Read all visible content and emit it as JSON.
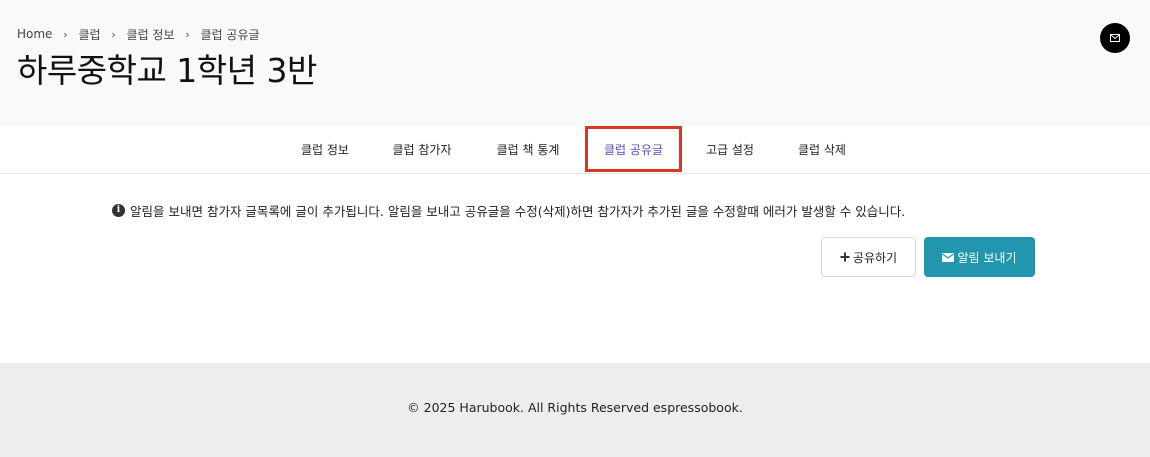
{
  "breadcrumb": {
    "items": [
      "Home",
      "클럽",
      "클럽 정보",
      "클럽 공유글"
    ]
  },
  "header": {
    "title": "하루중학교 1학년 3반"
  },
  "tabs": [
    {
      "label": "클럽 정보"
    },
    {
      "label": "클럽 참가자"
    },
    {
      "label": "클럽 책 통계"
    },
    {
      "label": "클럽 공유글",
      "active": true
    },
    {
      "label": "고급 설정"
    },
    {
      "label": "클럽 삭제"
    }
  ],
  "notice": {
    "text": "알림을 보내면 참가자 글목록에 글이 추가됩니다. 알림을 보내고 공유글을 수정(삭제)하면 참가자가 추가된 글을 수정할때 에러가 발생할 수 있습니다."
  },
  "actions": {
    "share_label": "공유하기",
    "notify_label": "알림 보내기"
  },
  "footer": {
    "copyright": "© 2025 Harubook. All Rights Reserved espressobook."
  },
  "colors": {
    "active_tab_border": "#d43a22",
    "active_tab_text": "#5b4ab8",
    "notify_button": "#2196ad",
    "footer_bg": "#edecef"
  }
}
